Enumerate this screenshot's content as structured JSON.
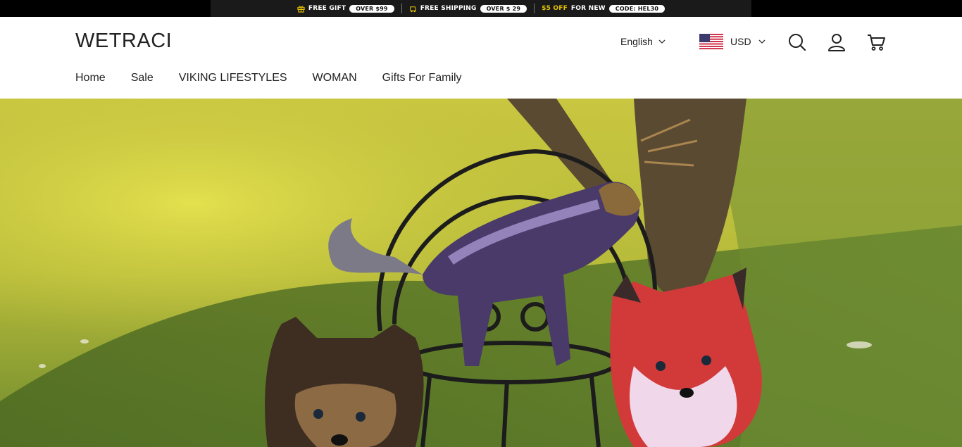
{
  "announcement": {
    "promo1": {
      "label": "FREE GIFT",
      "pill": "OVER $99",
      "icon": "gift-icon"
    },
    "promo2": {
      "label": "FREE SHIPPING",
      "pill": "OVER $ 29",
      "icon": "truck-icon"
    },
    "promo3": {
      "accent": "$5 OFF",
      "label": "FOR NEW",
      "pill": "CODE: HEL30"
    }
  },
  "header": {
    "logo": "WETRACI",
    "language": "English",
    "currency": "USD",
    "icons": [
      "search-icon",
      "account-icon",
      "cart-icon"
    ]
  },
  "nav": {
    "items": [
      "Home",
      "Sale",
      "VIKING LIFESTYLES",
      "WOMAN",
      "Gifts For Family"
    ]
  },
  "hero": {
    "image": "fantasy-creature-plush-photo"
  },
  "colors": {
    "bar": "#000000",
    "accent": "#e5c100",
    "text": "#222222"
  }
}
